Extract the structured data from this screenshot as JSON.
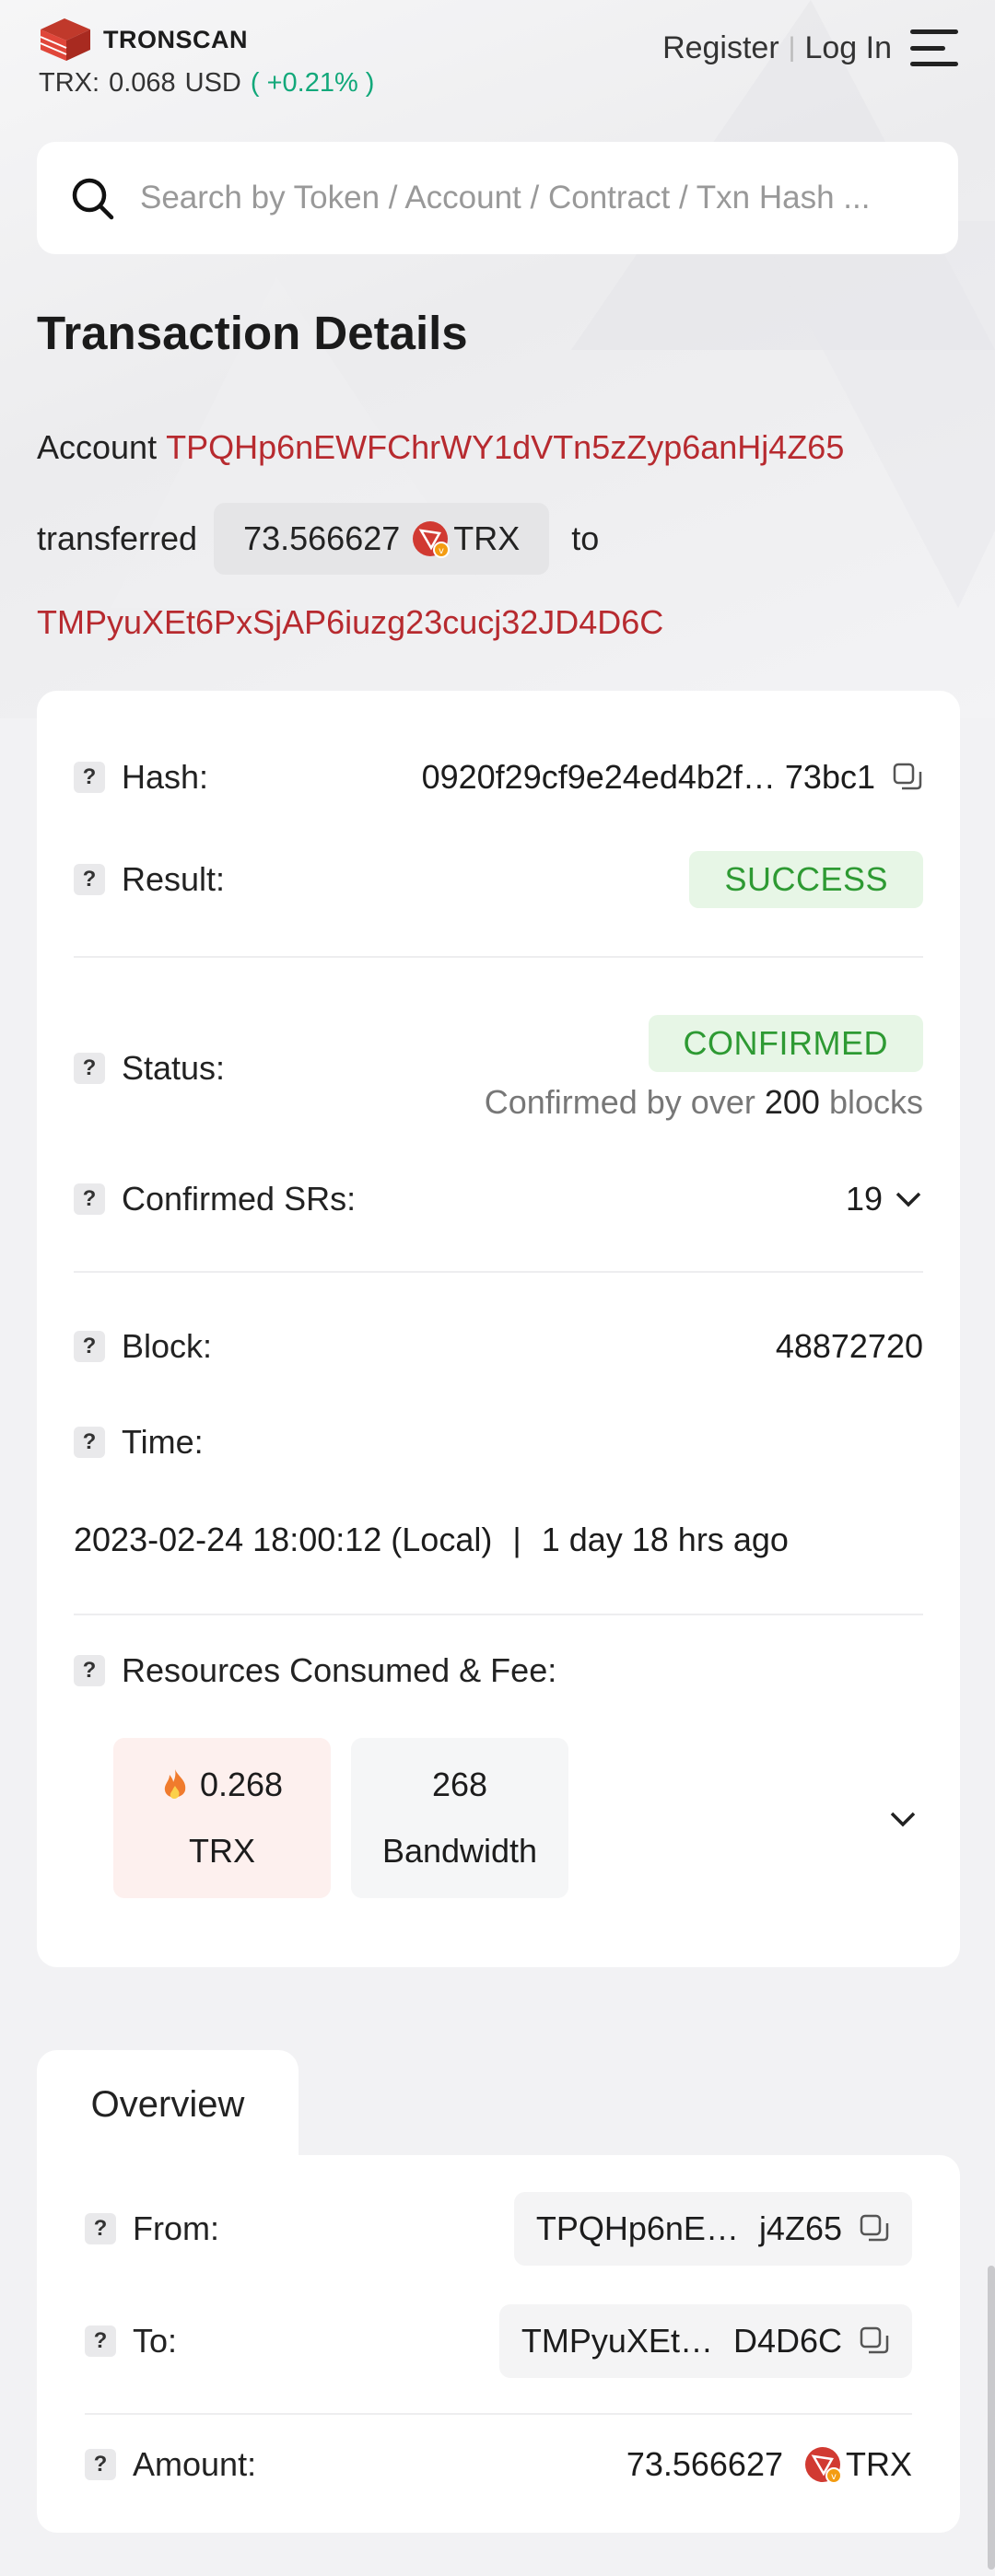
{
  "header": {
    "brand": "TRONSCAN",
    "price_label": "TRX:",
    "price_value": "0.068",
    "price_currency": "USD",
    "price_change": "( +0.21% )",
    "register": "Register",
    "separator": "|",
    "login": "Log In"
  },
  "search": {
    "placeholder": "Search by Token / Account / Contract / Txn Hash ..."
  },
  "page_title": "Transaction Details",
  "summary": {
    "account_label": "Account",
    "from_address": "TPQHp6nEWFChrWY1dVTn5zZyp6anHj4Z65",
    "transferred_label": "transferred",
    "amount": "73.566627",
    "token": "TRX",
    "to_label": "to",
    "to_address": "TMPyuXEt6PxSjAP6iuzg23cucj32JD4D6C"
  },
  "details": {
    "hash_label": "Hash:",
    "hash_value": "0920f29cf9e24ed4b2f… 73bc1",
    "result_label": "Result:",
    "result_value": "SUCCESS",
    "status_label": "Status:",
    "status_value": "CONFIRMED",
    "confirmed_prefix": "Confirmed by over",
    "confirmed_count": "200",
    "confirmed_suffix": "blocks",
    "srs_label": "Confirmed SRs:",
    "srs_value": "19",
    "block_label": "Block:",
    "block_value": "48872720",
    "time_label": "Time:",
    "time_value": "2023-02-24 18:00:12 (Local)",
    "time_sep": "|",
    "time_ago": "1 day 18 hrs ago",
    "resources_label": "Resources Consumed & Fee:",
    "fee_value": "0.268",
    "fee_unit": "TRX",
    "bandwidth_value": "268",
    "bandwidth_unit": "Bandwidth"
  },
  "overview": {
    "tab_label": "Overview",
    "from_label": "From:",
    "from_start": "TPQHp6nE…",
    "from_end": "j4Z65",
    "to_label": "To:",
    "to_start": "TMPyuXEt…",
    "to_end": "D4D6C",
    "amount_label": "Amount:",
    "amount_value": "73.566627",
    "amount_token": "TRX"
  },
  "colors": {
    "accent_red": "#b72a2f",
    "success_green": "#2e9a33",
    "change_green": "#12a87a"
  },
  "icons": [
    "tronscan-logo-icon",
    "menu-icon",
    "search-icon",
    "trx-token-icon",
    "help-icon",
    "copy-icon",
    "chevron-down-icon",
    "fire-icon"
  ]
}
